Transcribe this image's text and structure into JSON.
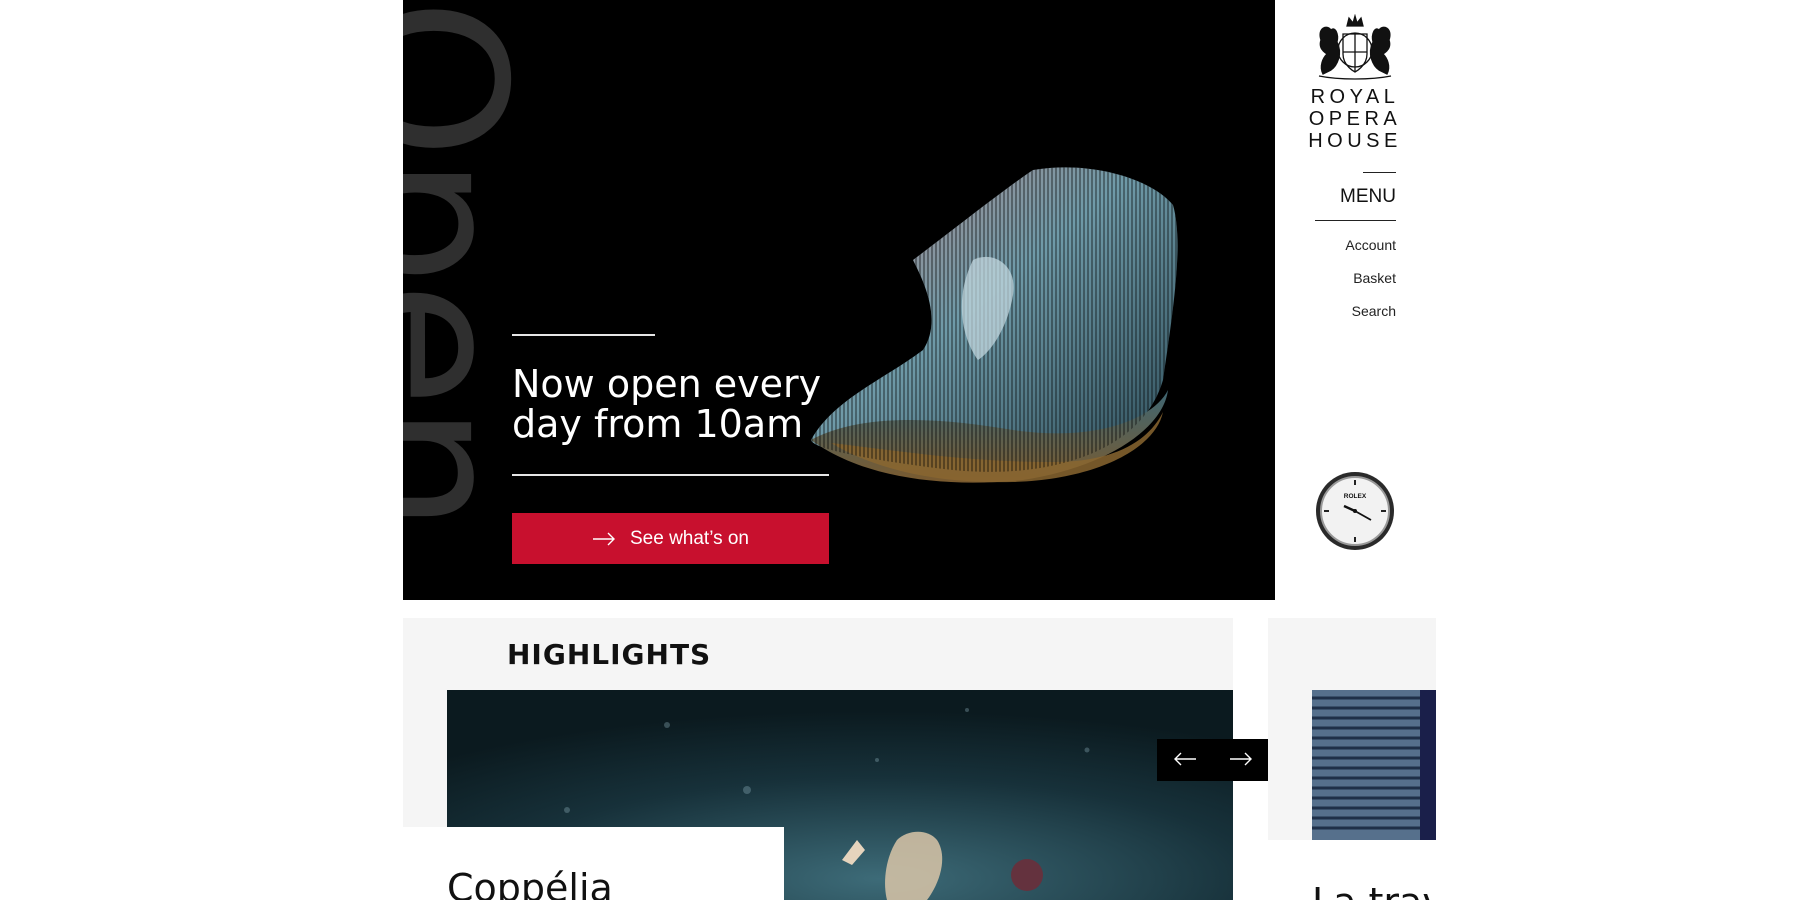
{
  "hero": {
    "watermark": "Open",
    "heading": "Now open every day from 10am",
    "cta_label": "See what’s on"
  },
  "brand": {
    "lines": [
      "ROYAL",
      "OPERA",
      "HOUSE"
    ]
  },
  "nav": {
    "menu_label": "MENU",
    "links": [
      "Account",
      "Basket",
      "Search"
    ]
  },
  "sponsor": {
    "clock_text": "ROLEX"
  },
  "highlights": {
    "title": "HIGHLIGHTS",
    "cards": [
      {
        "title": "Coppélia"
      },
      {
        "title": "La trav"
      }
    ]
  },
  "icons": {
    "cta": "arrow-right-icon",
    "prev": "arrow-left-icon",
    "next": "arrow-right-icon"
  },
  "colors": {
    "accent_red": "#c8102e",
    "hero_bg": "#000000",
    "panel_bg": "#f5f5f5",
    "watermark": "#2f2f2f"
  }
}
